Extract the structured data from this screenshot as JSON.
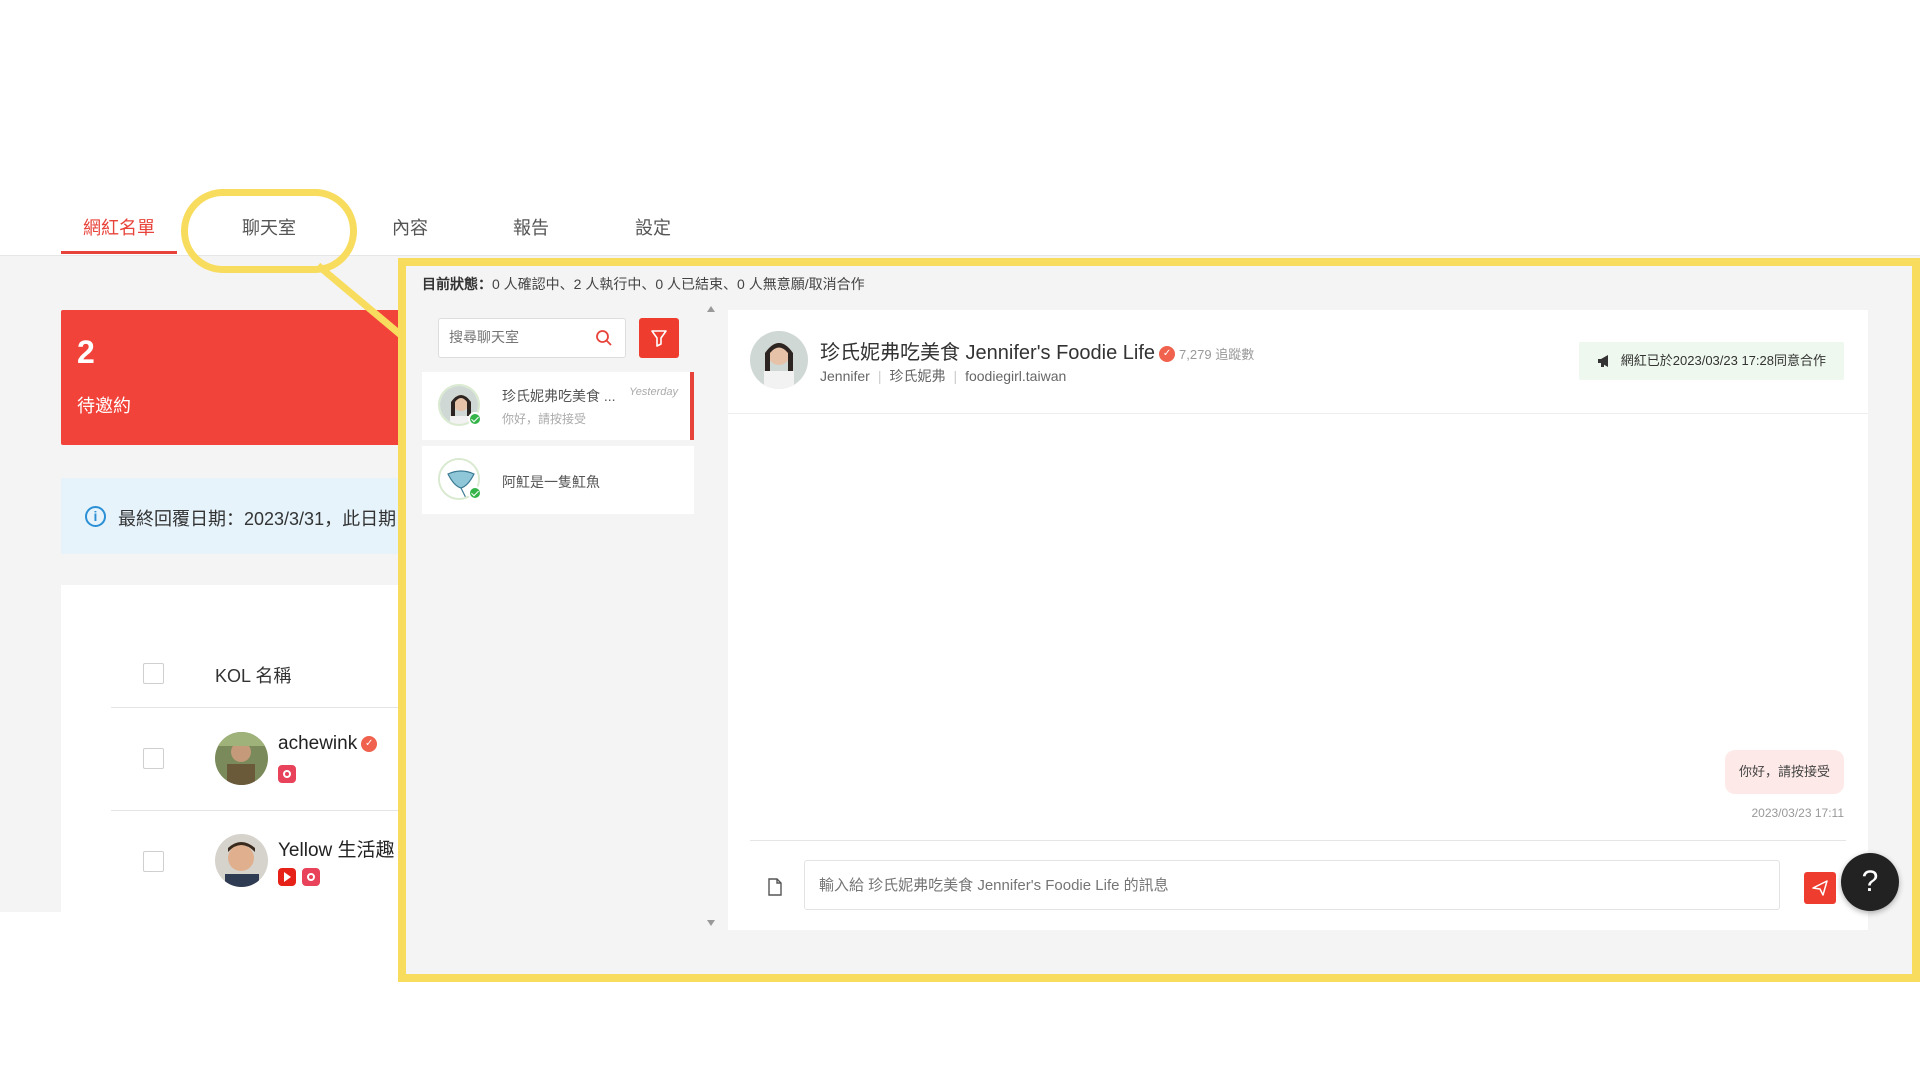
{
  "tabs": [
    {
      "label": "網紅名單",
      "active": true
    },
    {
      "label": "聊天室",
      "active": false
    },
    {
      "label": "內容",
      "active": false
    },
    {
      "label": "報告",
      "active": false
    },
    {
      "label": "設定",
      "active": false
    }
  ],
  "stat_card": {
    "count": "2",
    "label": "待邀約"
  },
  "info_bar": {
    "text": "最終回覆日期：2023/3/31，此日期"
  },
  "kol_table": {
    "header": "KOL 名稱",
    "rows": [
      {
        "name": "achewink",
        "verified": true,
        "platforms": [
          "instagram-icon"
        ]
      },
      {
        "name": "Yellow 生活趣",
        "verified": false,
        "platforms": [
          "youtube-icon",
          "instagram-icon"
        ]
      }
    ]
  },
  "chat": {
    "status_label": "目前狀態：",
    "status_text": "0 人確認中、2 人執行中、0 人已結束、0 人無意願/取消合作",
    "search_placeholder": "搜尋聊天室",
    "rooms": [
      {
        "name": "珍氏妮弗吃美食 ...",
        "time": "Yesterday",
        "preview": "你好，請按接受",
        "active": true
      },
      {
        "name": "阿魟是一隻魟魚",
        "time": "",
        "preview": "",
        "active": false
      }
    ],
    "conversation": {
      "title": "珍氏妮弗吃美食 Jennifer's Foodie Life",
      "followers": "7,279 追蹤數",
      "sub": [
        "Jennifer",
        "珍氏妮弗",
        "foodiegirl.taiwan"
      ],
      "agreement": "網紅已於2023/03/23 17:28同意合作",
      "messages": [
        {
          "text": "你好，請按接受",
          "time": "2023/03/23 17:11",
          "from": "me"
        }
      ],
      "input_placeholder": "輸入給 珍氏妮弗吃美食 Jennifer's Foodie Life 的訊息"
    }
  },
  "help": {
    "label": "?"
  },
  "colors": {
    "accent": "#e8433a",
    "highlight": "#f7dc5e",
    "online": "#35b44a"
  }
}
